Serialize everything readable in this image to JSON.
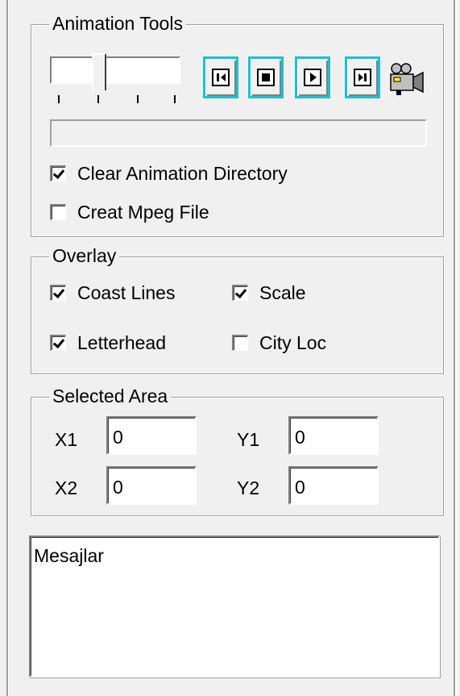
{
  "animation_tools": {
    "title": "Animation Tools",
    "buttons": {
      "prev": "step-back-icon",
      "stop": "stop-icon",
      "play": "play-icon",
      "next": "step-forward-icon",
      "record": "movie-camera-icon"
    },
    "clear_directory": {
      "label": "Clear Animation Directory",
      "checked": true
    },
    "mpeg_file": {
      "label": "Creat Mpeg File",
      "checked": false
    }
  },
  "overlay": {
    "title": "Overlay",
    "coast_lines": {
      "label": "Coast Lines",
      "checked": true
    },
    "scale": {
      "label": "Scale",
      "checked": true
    },
    "letterhead": {
      "label": "Letterhead",
      "checked": true
    },
    "city_loc": {
      "label": "City Loc",
      "checked": false
    }
  },
  "selected_area": {
    "title": "Selected Area",
    "x1": {
      "label": "X1",
      "value": "0"
    },
    "y1": {
      "label": "Y1",
      "value": "0"
    },
    "x2": {
      "label": "X2",
      "value": "0"
    },
    "y2": {
      "label": "Y2",
      "value": "0"
    }
  },
  "messages": {
    "text": "Mesajlar"
  },
  "colors": {
    "button_focus_border": "#17c3d6",
    "panel_bg": "#f0f0f0"
  }
}
